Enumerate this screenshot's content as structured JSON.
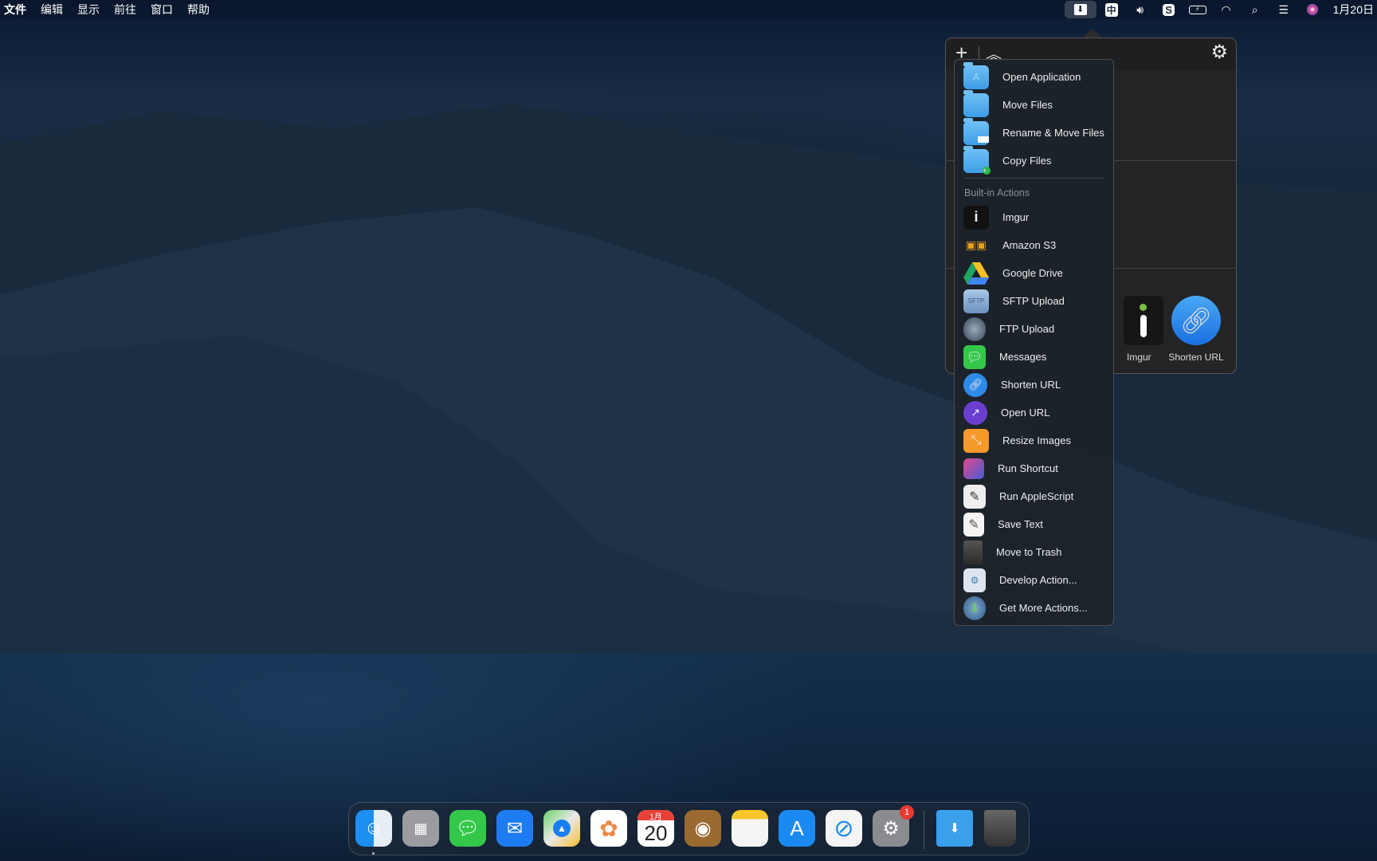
{
  "menubar": {
    "items": [
      "文件",
      "编辑",
      "显示",
      "前往",
      "窗口",
      "帮助"
    ],
    "date": "1月20日",
    "status_icons": [
      "dropzone-icon",
      "input-method-icon",
      "volume-icon",
      "s-app-icon",
      "battery-charging-icon",
      "wifi-icon",
      "search-icon",
      "control-center-icon",
      "siri-icon"
    ],
    "input_method": "中"
  },
  "popover": {
    "add_icon": "plus-icon",
    "collapse_icon": "double-chevron-up-icon",
    "settings_icon": "gear-icon",
    "grid_items": [
      {
        "label": "Imgur"
      },
      {
        "label": "Shorten URL"
      }
    ]
  },
  "menu": {
    "top_items": [
      {
        "label": "Open Application"
      },
      {
        "label": "Move Files"
      },
      {
        "label": "Rename & Move Files"
      },
      {
        "label": "Copy Files"
      }
    ],
    "section_header": "Built-in Actions",
    "items": [
      {
        "label": "Imgur"
      },
      {
        "label": "Amazon S3"
      },
      {
        "label": "Google Drive"
      },
      {
        "label": "SFTP Upload"
      },
      {
        "label": "FTP Upload"
      },
      {
        "label": "Messages"
      },
      {
        "label": "Shorten URL"
      },
      {
        "label": "Open URL"
      },
      {
        "label": "Resize Images"
      },
      {
        "label": "Run Shortcut"
      },
      {
        "label": "Run AppleScript"
      },
      {
        "label": "Save Text"
      },
      {
        "label": "Move to Trash"
      },
      {
        "label": "Develop Action..."
      },
      {
        "label": "Get More Actions..."
      }
    ]
  },
  "dock": {
    "apps": [
      "Finder",
      "Launchpad",
      "Messages",
      "Mail",
      "Maps",
      "Photos",
      "Calendar",
      "Contacts",
      "Notes",
      "App Store",
      "Safari",
      "System Preferences",
      "Downloads",
      "Trash"
    ],
    "calendar_month": "1月",
    "calendar_day": "20",
    "settings_badge": "1"
  }
}
